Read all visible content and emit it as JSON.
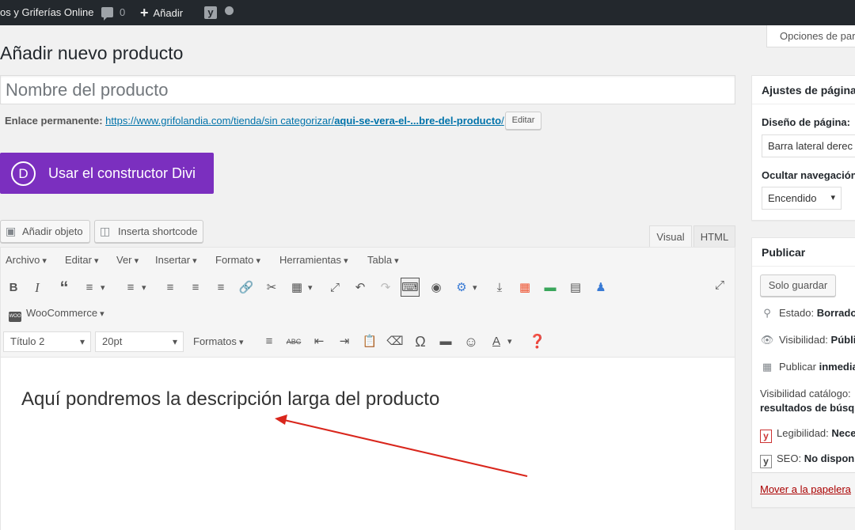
{
  "admin_bar": {
    "site_name": "os y Griferías Online",
    "comments_count": "0",
    "new_label": "Añadir",
    "yoast_letter": "y"
  },
  "screen_options": "Opciones de par",
  "page_title": "Añadir nuevo producto",
  "title_placeholder": "Nombre del producto",
  "permalink": {
    "label": "Enlace permanente:",
    "url": "https://www.grifolandia.com/tienda/sin categorizar/",
    "slug": "aqui-se-vera-el-...bre-del-producto",
    "trail": "/",
    "edit_label": "Editar"
  },
  "divi": {
    "logo_letter": "D",
    "label": "Usar el constructor Divi"
  },
  "media_buttons": {
    "add_media": "Añadir objeto",
    "shortcode": "Inserta shortcode"
  },
  "editor_tabs": {
    "visual": "Visual",
    "html": "HTML"
  },
  "menubar": [
    "Archivo",
    "Editar",
    "Ver",
    "Insertar",
    "Formato",
    "Herramientas",
    "Tabla"
  ],
  "woocommerce_menu": "WooCommerce",
  "woo_icon_text": "WOO",
  "format_select": "Título 2",
  "size_select": "20pt",
  "formats_menu": "Formatos",
  "content_text": "Aquí pondremos la descripción larga del producto",
  "annotation_arrow_color": "#d9261c",
  "page_settings": {
    "title": "Ajustes de página d",
    "layout_label": "Diseño de página:",
    "layout_value": "Barra lateral derec",
    "hide_nav_label": "Ocultar navegación",
    "hide_nav_value": "Encendido"
  },
  "publish": {
    "title": "Publicar",
    "save_draft": "Solo guardar",
    "status_label": "Estado:",
    "status_value": "Borrador",
    "visibility_label": "Visibilidad:",
    "visibility_value": "Públi",
    "publish_label": "Publicar",
    "publish_value": "inmedia",
    "catalog_line1": "Visibilidad catálogo:",
    "catalog_line2": "resultados de búsque",
    "readability_label": "Legibilidad:",
    "readability_value": "Nece",
    "seo_label": "SEO:",
    "seo_value": "No disponib",
    "trash": "Mover a la papelera"
  },
  "colors": {
    "divi_purple": "#7b2fbf",
    "admin_bar": "#23282d",
    "link": "#0073aa",
    "trash": "#aa0000"
  }
}
